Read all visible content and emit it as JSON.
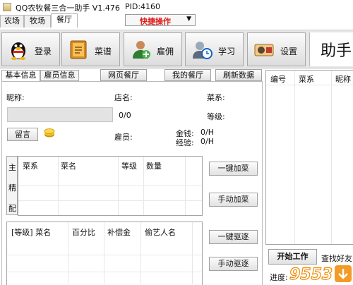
{
  "window": {
    "title": "QQ农牧餐三合一助手 V1.476",
    "pid": "PID:4160"
  },
  "main_tabs": [
    {
      "label": "农场"
    },
    {
      "label": "牧场"
    },
    {
      "label": "餐厅"
    }
  ],
  "quick_action": {
    "label": "快捷操作"
  },
  "toolbar": {
    "login": "登录",
    "menu": "菜谱",
    "hire": "雇佣",
    "learn": "学习",
    "settings": "设置",
    "helper_title": "助手"
  },
  "sub_tabs": {
    "basic": "基本信息",
    "employee": "雇员信息",
    "web_restaurant": "网页餐厅",
    "my_restaurant": "我的餐厅",
    "refresh": "刷新数据"
  },
  "info": {
    "nickname_label": "昵称:",
    "shop_label": "店名:",
    "cuisine_label": "菜系:",
    "level_label": "等级:",
    "progress_text": "0/0",
    "message_button": "留言",
    "employee_label": "雇员:",
    "money_label": "金钱:",
    "money_value": "0/H",
    "exp_label": "经验:",
    "exp_value": "0/H"
  },
  "side_labels": [
    "主",
    "精",
    "配"
  ],
  "dish_table": {
    "columns": [
      "菜系",
      "菜名",
      "等级",
      "数量"
    ]
  },
  "dish_buttons": {
    "one_click": "一键加菜",
    "manual": "手动加菜"
  },
  "artist_table": {
    "columns": [
      "[等级] 菜名",
      "百分比",
      "补偿金",
      "偷艺人名"
    ]
  },
  "expel_buttons": {
    "one_click": "一键驱逐",
    "manual": "手动驱逐"
  },
  "right_table": {
    "columns": [
      "编号",
      "菜系",
      "昵称"
    ]
  },
  "bottom": {
    "start_button": "开始工作",
    "find_friend": "查找好友",
    "progress_label": "进度:"
  },
  "watermark": "9553下载"
}
